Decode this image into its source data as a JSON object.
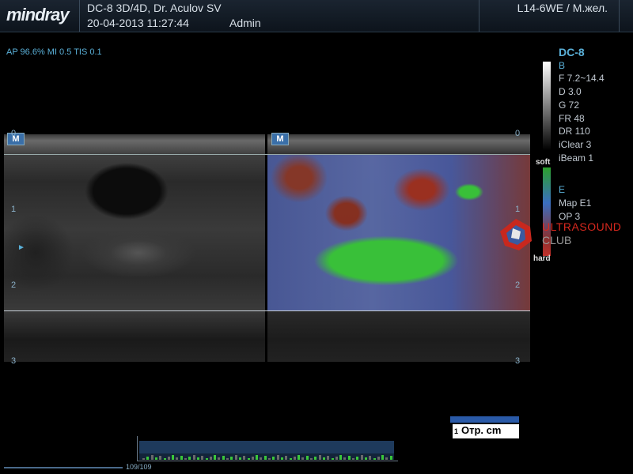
{
  "header": {
    "brand": "mindray",
    "line1": "DC-8  3D/4D,  Dr. Aculov  SV",
    "line2": "20-04-2013  11:27:44",
    "user": "Admin",
    "probe": "L14-6WE / М.жел."
  },
  "power": "AP 96.6%  MI 0.5  TIS 0.1",
  "right_panel": {
    "model": "DC-8",
    "b_label": "B",
    "b_params": [
      "F 7.2~14.4",
      "D 3.0",
      "G 72",
      "FR 48",
      "DR 110",
      "iClear 3",
      "iBeam 1"
    ],
    "e_label": "E",
    "e_params": [
      "Map E1",
      "OP 3"
    ],
    "soft": "soft",
    "hard": "hard"
  },
  "icons": {
    "left": "M",
    "right": "M"
  },
  "depth": {
    "left": [
      "0",
      "1",
      "2",
      "3"
    ],
    "right": [
      "0",
      "1",
      "2",
      "3"
    ]
  },
  "watermark": {
    "line1": "ULTRASOUND",
    "line2": "CLUB"
  },
  "scale": {
    "num": "1",
    "label": "Отр.   cm"
  },
  "cine": {
    "counter": "109/109"
  }
}
